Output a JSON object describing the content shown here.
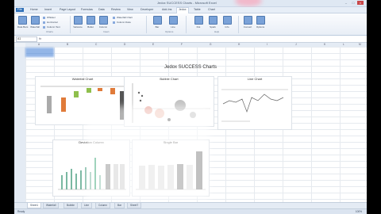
{
  "window": {
    "title": "Jedox SUCCESS Charts - Microsoft Excel"
  },
  "ribbon": {
    "tabs": [
      "File",
      "Home",
      "Insert",
      "Page Layout",
      "Formulas",
      "Data",
      "Review",
      "View",
      "Developer",
      "Add-Ins",
      "Jedox",
      "Table",
      "Chart"
    ],
    "active_tab": "Jedox",
    "buttons": [
      "Data Bars",
      "Waterfall",
      "Variance",
      "Bullet",
      "Column",
      "Bar",
      "Line",
      "Dot",
      "Spark",
      "Info",
      "Convert",
      "Options"
    ],
    "small_items": [
      "Whisker",
      "Horizontal",
      "Column Text",
      "Waterfall Chart",
      "Column Data"
    ],
    "groups": [
      "Charts",
      "Insert",
      "Options",
      "Help"
    ]
  },
  "formula_bar": {
    "name_box": "A1",
    "fx": "fx"
  },
  "sheet": {
    "title": "Jedox SUCCESS Charts",
    "columns": [
      "A",
      "B",
      "C",
      "D",
      "E",
      "F",
      "G",
      "H",
      "I",
      "J",
      "K",
      "L",
      "M"
    ]
  },
  "charts": {
    "waterfall": {
      "title": "Waterfall Chart"
    },
    "bubble": {
      "title": "Bubble Chart"
    },
    "line": {
      "title": "Line Chart"
    },
    "columns": {
      "title": "Deviation Column"
    },
    "single": {
      "title": "Single Bar"
    }
  },
  "sheet_tabs": [
    "Sheet1",
    "Waterfall",
    "Bubble",
    "Line",
    "Column",
    "Bar",
    "Sheet7"
  ],
  "active_sheet_tab": "Sheet1",
  "status": {
    "left": "Ready",
    "zoom": "100%"
  }
}
